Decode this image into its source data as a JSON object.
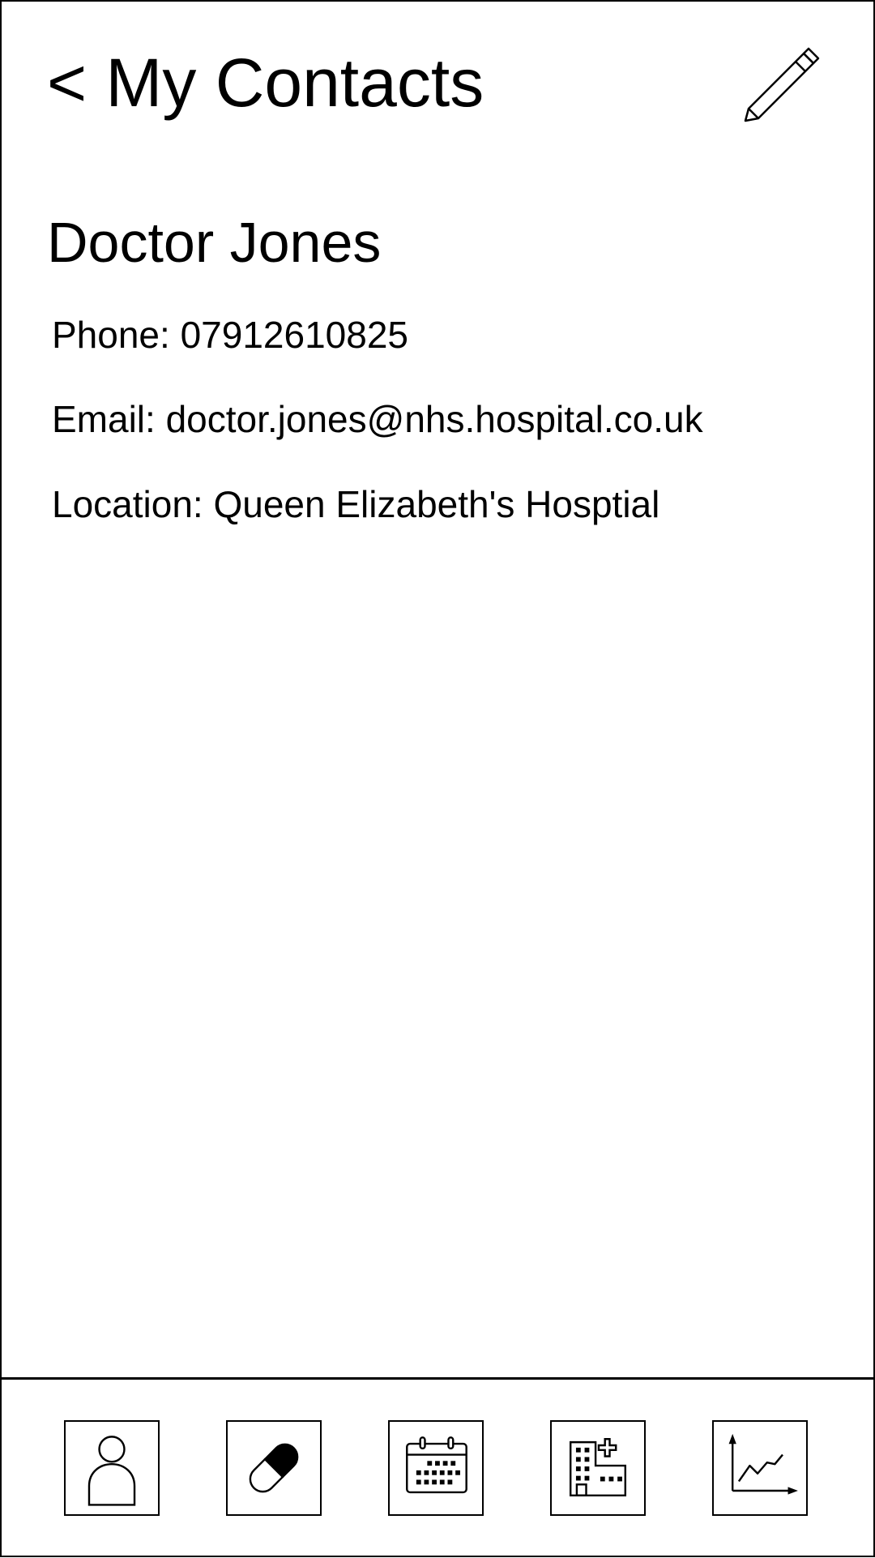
{
  "header": {
    "back_label": "< My Contacts",
    "edit_icon": "pencil-icon"
  },
  "contact": {
    "name": "Doctor Jones",
    "phone": "Phone: 07912610825",
    "email": "Email: doctor.jones@nhs.hospital.co.uk",
    "location": "Location: Queen Elizabeth's Hosptial"
  },
  "bottom_nav": {
    "items": [
      {
        "icon": "person-icon"
      },
      {
        "icon": "pill-icon"
      },
      {
        "icon": "calendar-icon"
      },
      {
        "icon": "hospital-icon"
      },
      {
        "icon": "chart-icon"
      }
    ]
  },
  "colors": {
    "foreground": "#000000",
    "background": "#ffffff"
  }
}
